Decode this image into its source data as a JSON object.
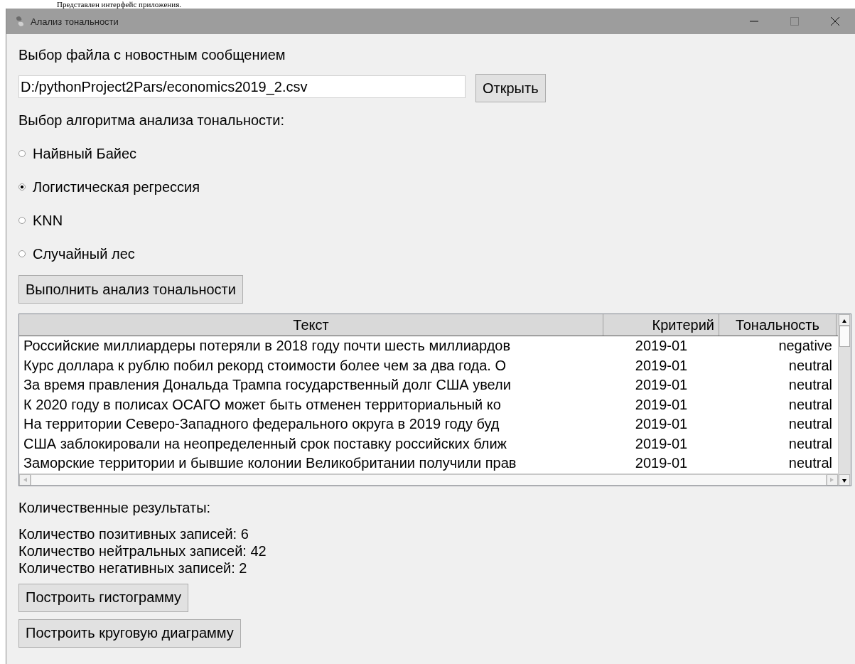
{
  "caption": "Представлен интерфейс приложения.",
  "window": {
    "title": "Алализ тональности"
  },
  "file_label": "Выбор файла с новостным сообщением",
  "file_path": {
    "value": "D:/pythonProject2Pars/economics2019_2.csv"
  },
  "open_button": "Открыть",
  "algorithm_label": "Выбор алгоритма анализа тональности:",
  "algorithms": [
    {
      "label": "Найвный Байес",
      "selected": false
    },
    {
      "label": "Логистическая регрессия",
      "selected": true
    },
    {
      "label": "KNN",
      "selected": false
    },
    {
      "label": "Случайный лес",
      "selected": false
    }
  ],
  "run_button": "Выполнить анализ тональности",
  "table": {
    "columns": [
      "Текст",
      "Критерий",
      "Тональность"
    ],
    "rows": [
      [
        "Российские миллиардеры потеряли в 2018 году почти шесть миллиардов",
        "2019-01",
        "negative"
      ],
      [
        "Курс доллара к рублю побил рекорд стоимости более чем за два года. О",
        "2019-01",
        "neutral"
      ],
      [
        "За время правления Дональда Трампа государственный долг США увели",
        "2019-01",
        "neutral"
      ],
      [
        "К 2020 году в полисах ОСАГО может быть отменен территориальный ко",
        "2019-01",
        "neutral"
      ],
      [
        "На территории Северо-Западного федерального округа в 2019 году буд",
        "2019-01",
        "neutral"
      ],
      [
        "США заблокировали на неопределенный срок поставку российских ближ",
        "2019-01",
        "neutral"
      ],
      [
        "Заморские территории и бывшие колонии Великобритании получили прав",
        "2019-01",
        "neutral"
      ]
    ]
  },
  "results_label": "Количественные результаты:",
  "counts": [
    "Количество позитивных записей: 6",
    "Количество нейтральных записей: 42",
    "Количество негативных записей: 2"
  ],
  "buttons": [
    "Построить гистограмму",
    "Построить круговую диаграмму"
  ]
}
